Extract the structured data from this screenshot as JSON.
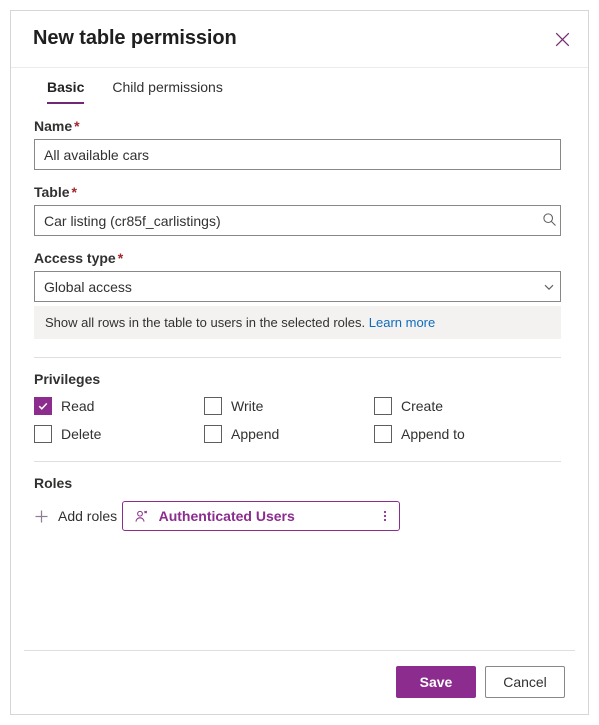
{
  "dialog": {
    "title": "New table permission",
    "close_icon": "close-icon"
  },
  "tabs": [
    {
      "label": "Basic",
      "active": true
    },
    {
      "label": "Child permissions",
      "active": false
    }
  ],
  "fields": {
    "name": {
      "label": "Name",
      "required_marker": "*",
      "value": "All available cars",
      "placeholder": ""
    },
    "table": {
      "label": "Table",
      "required_marker": "*",
      "value": "Car listing (cr85f_carlistings)",
      "placeholder": "",
      "icon": "search-icon"
    },
    "access_type": {
      "label": "Access type",
      "required_marker": "*",
      "value": "Global access",
      "icon": "chevron-down-icon"
    }
  },
  "info_banner": {
    "text": "Show all rows in the table to users in the selected roles.",
    "link_text": "Learn more"
  },
  "privileges": {
    "title": "Privileges",
    "items": [
      {
        "label": "Read",
        "checked": true
      },
      {
        "label": "Write",
        "checked": false
      },
      {
        "label": "Create",
        "checked": false
      },
      {
        "label": "Delete",
        "checked": false
      },
      {
        "label": "Append",
        "checked": false
      },
      {
        "label": "Append to",
        "checked": false
      }
    ]
  },
  "roles": {
    "title": "Roles",
    "add_label": "Add roles",
    "add_icon": "plus-icon",
    "chips": [
      {
        "label": "Authenticated Users",
        "icon": "person-icon",
        "menu_icon": "more-vertical-icon"
      }
    ]
  },
  "footer": {
    "save_label": "Save",
    "cancel_label": "Cancel"
  },
  "colors": {
    "accent_purple": "#8b2c8e",
    "tab_underline": "#742774",
    "link_blue": "#0f6cbd",
    "required_red": "#a4262c",
    "banner_bg": "#f3f2f1"
  }
}
